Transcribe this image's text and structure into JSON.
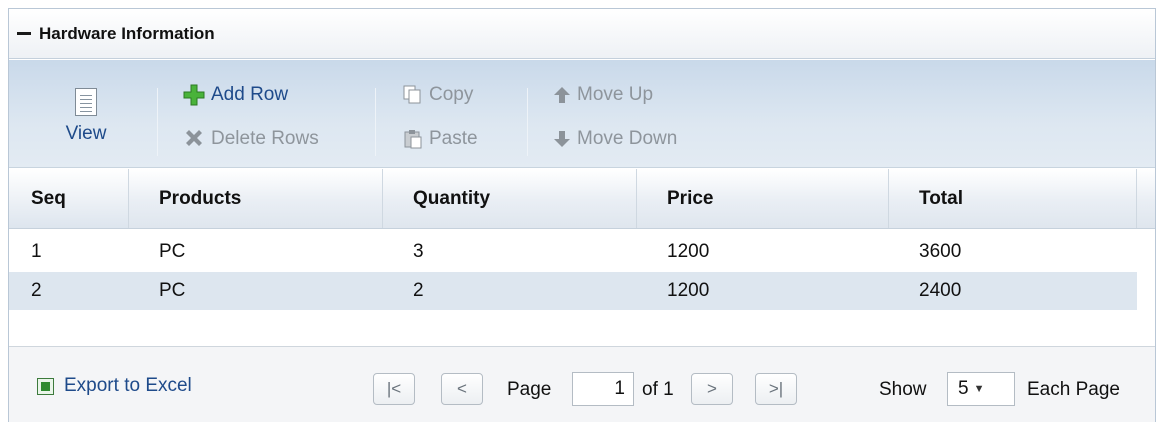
{
  "panel": {
    "title": "Hardware Information"
  },
  "toolbar": {
    "view": "View",
    "add_row": "Add Row",
    "delete_rows": "Delete Rows",
    "copy": "Copy",
    "paste": "Paste",
    "move_up": "Move Up",
    "move_down": "Move Down"
  },
  "columns": [
    "Seq",
    "Products",
    "Quantity",
    "Price",
    "Total"
  ],
  "rows": [
    {
      "seq": "1",
      "product": "PC",
      "quantity": "3",
      "price": "1200",
      "total": "3600"
    },
    {
      "seq": "2",
      "product": "PC",
      "quantity": "2",
      "price": "1200",
      "total": "2400"
    }
  ],
  "footer": {
    "export": "Export to Excel",
    "page_label": "Page",
    "page_value": "1",
    "of_label": "of 1",
    "show_label": "Show",
    "page_size": "5",
    "each_page": "Each Page"
  },
  "colors": {
    "link": "#1e4a8a",
    "alt_row": "#dde6ef",
    "toolbar_top": "#c9d9ea"
  }
}
